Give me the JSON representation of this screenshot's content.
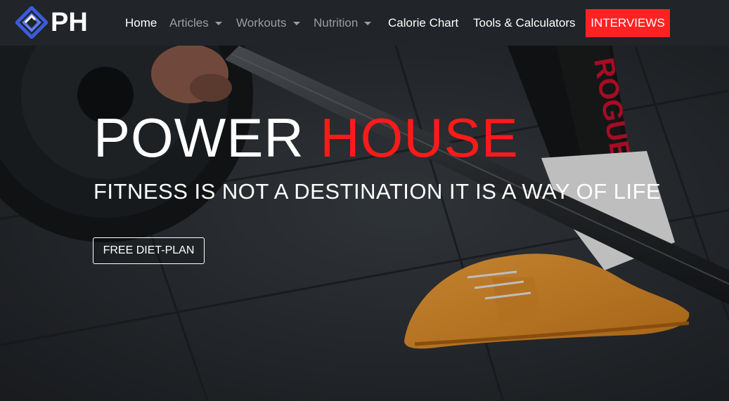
{
  "brand": {
    "text": "PH",
    "logo_icon": "ph-diamond-logo-icon",
    "logo_color": "#3b5bd9"
  },
  "nav": {
    "home": "Home",
    "articles": "Articles",
    "workouts": "Workouts",
    "nutrition": "Nutrition",
    "calorie_chart": "Calorie Chart",
    "tools": "Tools & Calculators",
    "interviews": "INTERVIEWS"
  },
  "colors": {
    "navbar_bg": "#212428",
    "accent_red": "#ff2222",
    "active_text": "#ffffff",
    "muted_text": "#9a9da1"
  },
  "hero": {
    "title_part1": "POWER",
    "title_part2": "HOUSE",
    "subtitle": "FITNESS IS NOT A DESTINATION IT IS A WAY OF LIFE",
    "cta_label": "FREE DIET-PLAN",
    "sock_text": "ROGUE"
  }
}
